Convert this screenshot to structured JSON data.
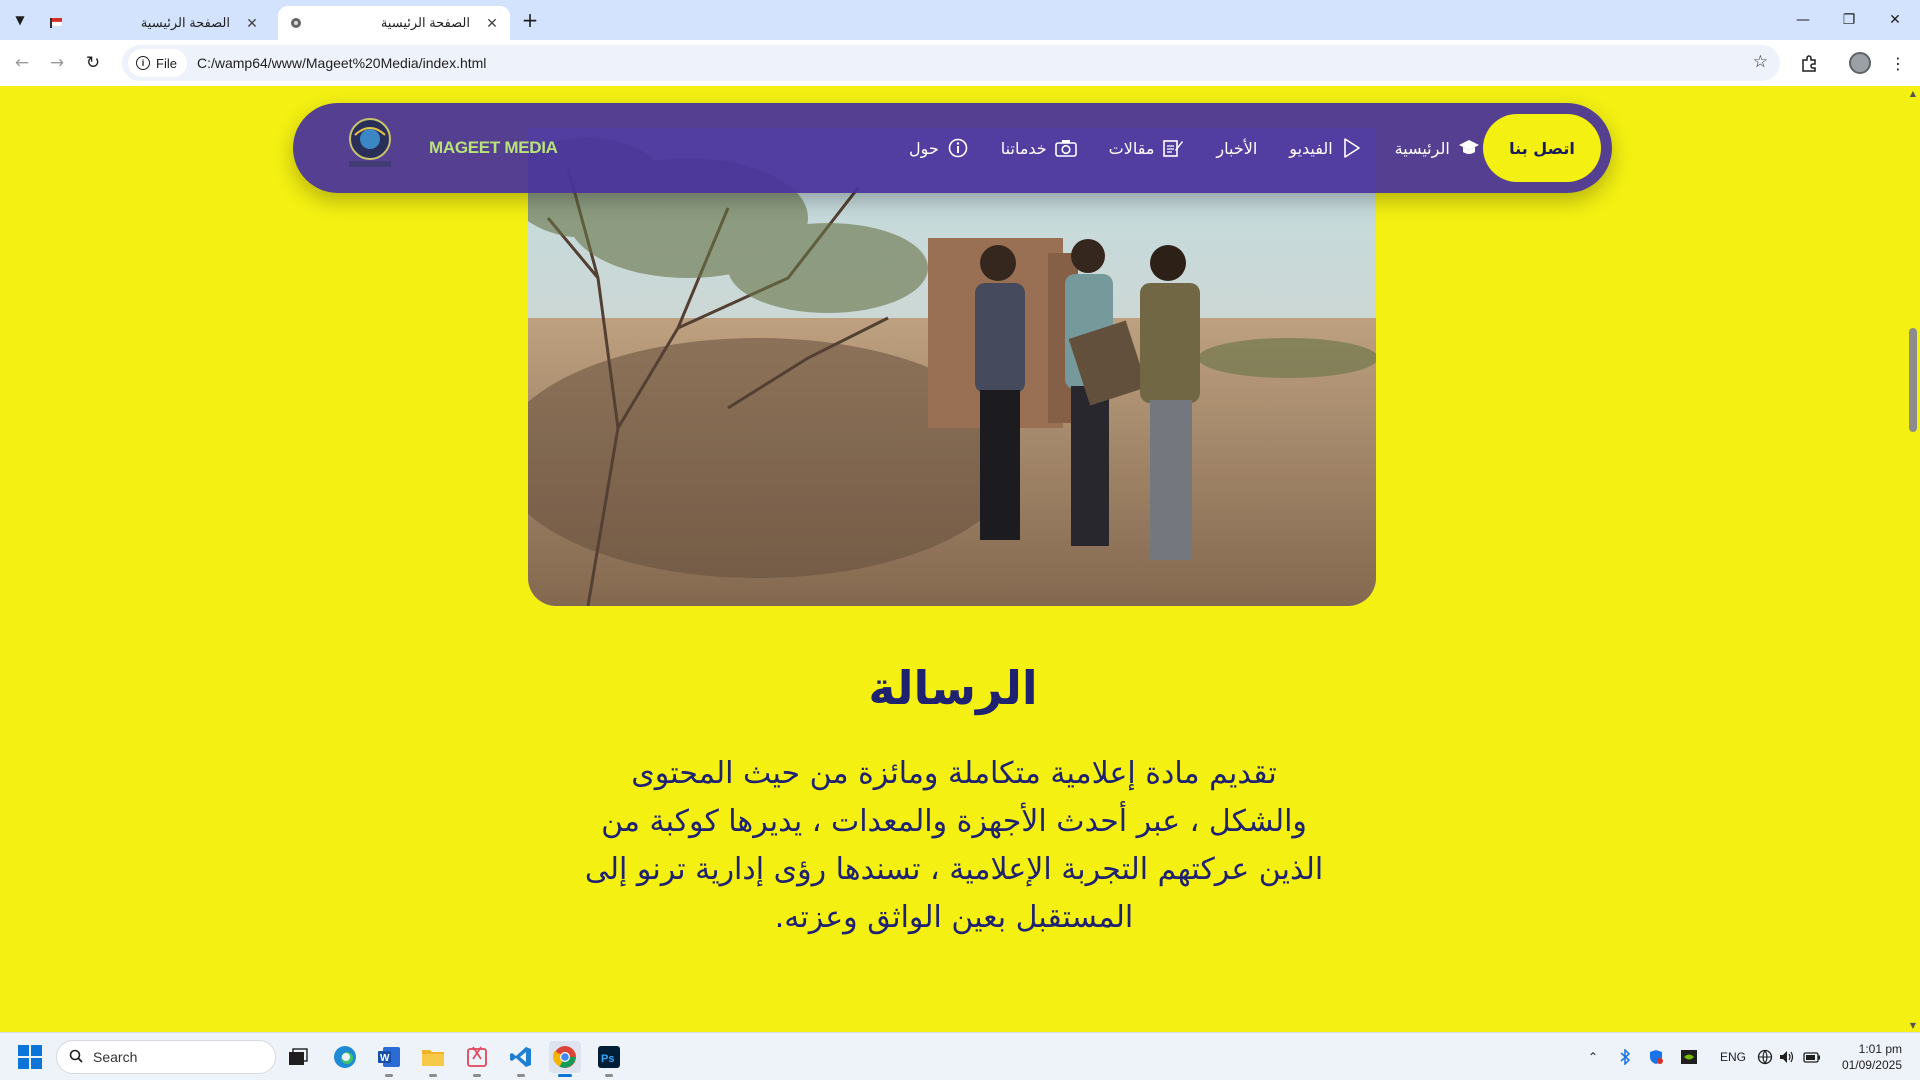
{
  "browser": {
    "tabs": [
      {
        "title": "الصفحة الرئيسية",
        "active": false
      },
      {
        "title": "الصفحة الرئيسية",
        "active": true
      }
    ],
    "new_tab_symbol": "+",
    "address_chip": "File",
    "url": "C:/wamp64/www/Mageet%20Media/index.html"
  },
  "site": {
    "brand": "MAGEET MEDIA",
    "nav": {
      "contact": "اتصل بنا",
      "items": [
        {
          "label": "حول",
          "icon": "info-circle-icon"
        },
        {
          "label": "خدماتنا",
          "icon": "camera-icon"
        },
        {
          "label": "مقالات",
          "icon": "edit-note-icon"
        },
        {
          "label": "الأخبار",
          "icon": ""
        },
        {
          "label": "الفيديو",
          "icon": "play-icon"
        },
        {
          "label": "الرئيسية",
          "icon": "graduation-cap-icon"
        }
      ]
    },
    "mission": {
      "title": "الرسالة",
      "lines": [
        "تقديم مادة إعلامية متكاملة ومائزة من حيث المحتوى",
        "والشكل ، عبر أحدث الأجهزة والمعدات ، يديرها كوكبة من",
        "الذين عركتهم التجربة الإعلامية ، تسندها رؤى إدارية ترنو إلى",
        "المستقبل بعين الواثق وعزته."
      ]
    }
  },
  "taskbar": {
    "search_placeholder": "Search",
    "language": "ENG",
    "time": "1:01 pm",
    "date": "01/09/2025"
  },
  "colors": {
    "page_background": "#f3f012",
    "navbar": "#48329b",
    "heading_text": "#1f2270",
    "brand_text": "#b9e27a"
  }
}
